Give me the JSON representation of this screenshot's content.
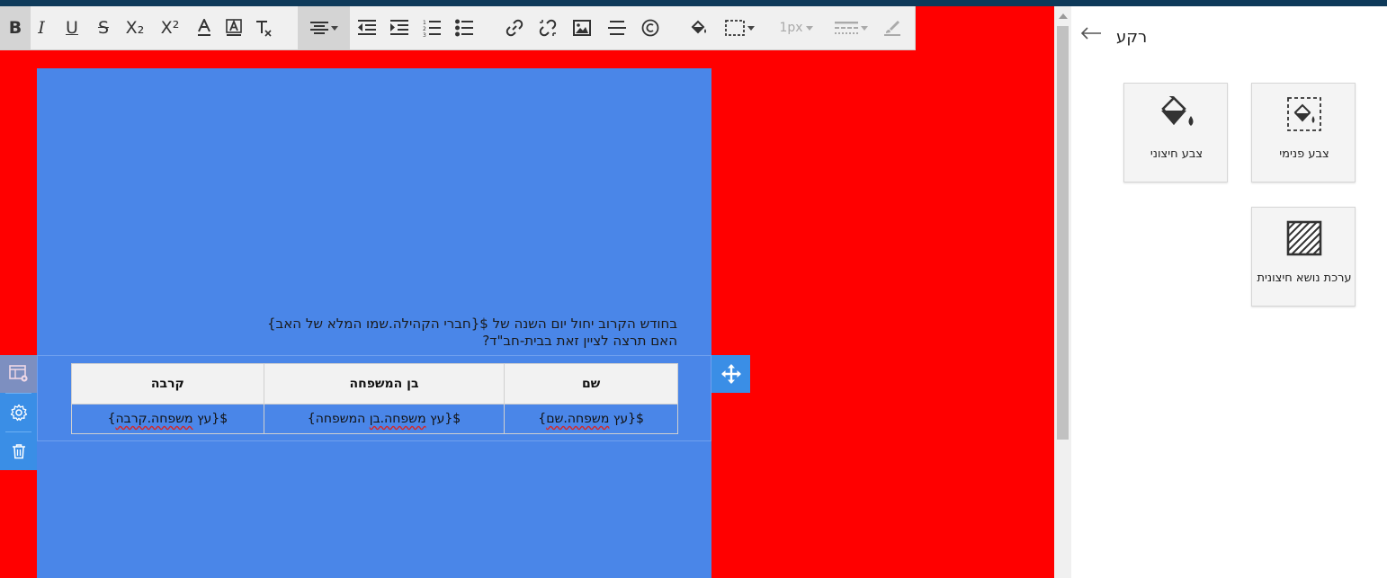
{
  "toolbar": {
    "buttons": {
      "bold": "B",
      "italic": "I",
      "underline": "U",
      "strike": "S",
      "subscript": "X₂",
      "superscript": "X²",
      "line_size": "1px"
    }
  },
  "editor": {
    "lines": [
      "בחודש הקרוב יחול יום השנה של ${חברי הקהילה.שמו המלא של האב}",
      "האם תרצה לציין זאת בבית-חב\"ד?"
    ],
    "table": {
      "headers": [
        "שם",
        "בן המשפחה",
        "קרבה"
      ],
      "row": [
        {
          "prefix": "$",
          "open": "{עץ ",
          "squig": "משפחה.שם",
          "close": "}"
        },
        {
          "prefix": "$",
          "open": "{עץ ",
          "squig": "משפחה.בן",
          "close": " המשפחה}"
        },
        {
          "prefix": "$",
          "open": "{עץ ",
          "squig": "משפחה.קרבה",
          "close": "}"
        }
      ]
    }
  },
  "panel": {
    "title": "רקע",
    "cards": [
      {
        "label": "צבע פנימי",
        "icon": "inner-fill-icon"
      },
      {
        "label": "צבע חיצוני",
        "icon": "outer-fill-icon"
      },
      {
        "label": "ערכת נושא חיצונית",
        "icon": "hatch-pattern-icon"
      }
    ]
  },
  "colors": {
    "outer_background": "#ff0000",
    "inner_block": "#4a86e8",
    "accent": "#3a8ee6"
  }
}
